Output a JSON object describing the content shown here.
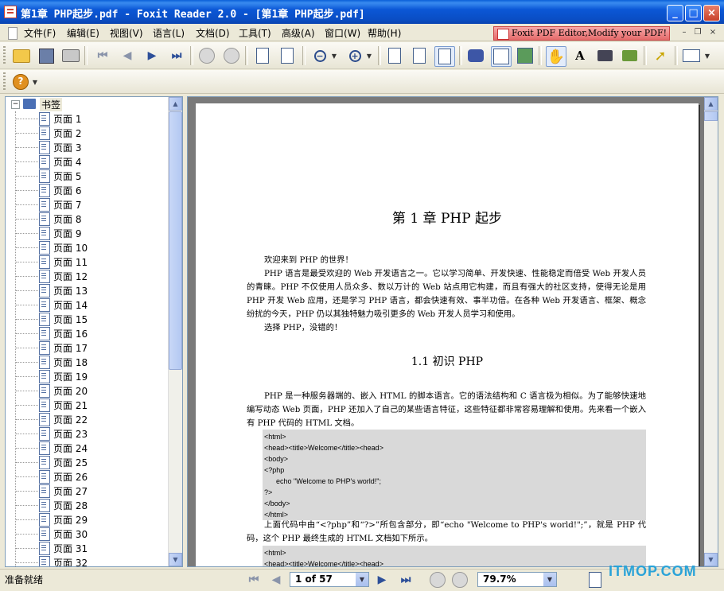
{
  "window": {
    "title": "第1章  PHP起步.pdf - Foxit Reader 2.0 - [第1章  PHP起步.pdf]",
    "minimize": "_",
    "maximize": "□",
    "close": "×"
  },
  "menu": {
    "items": [
      "文件(F)",
      "编辑(E)",
      "视图(V)",
      "语言(L)",
      "文档(D)",
      "工具(T)",
      "高级(A)",
      "窗口(W)",
      "帮助(H)"
    ],
    "promo": "Foxit PDF Editor,Modify your PDF!",
    "mdi_min": "–",
    "mdi_restore": "❐",
    "mdi_close": "×"
  },
  "toolbar": {
    "zoom_out": "−",
    "zoom_in": "+",
    "text_tool": "A",
    "help": "?"
  },
  "bookmarks": {
    "root": "书签",
    "toggle": "−",
    "items": [
      "页面 1",
      "页面 2",
      "页面 3",
      "页面 4",
      "页面 5",
      "页面 6",
      "页面 7",
      "页面 8",
      "页面 9",
      "页面 10",
      "页面 11",
      "页面 12",
      "页面 13",
      "页面 14",
      "页面 15",
      "页面 16",
      "页面 17",
      "页面 18",
      "页面 19",
      "页面 20",
      "页面 21",
      "页面 22",
      "页面 23",
      "页面 24",
      "页面 25",
      "页面 26",
      "页面 27",
      "页面 28",
      "页面 29",
      "页面 30",
      "页面 31",
      "页面 32"
    ]
  },
  "document": {
    "chapter_title": "第 1 章    PHP 起步",
    "intro_line": "欢迎来到 PHP 的世界！",
    "intro_para": "PHP 语言是最受欢迎的 Web 开发语言之一。它以学习简单、开发快速、性能稳定而倍受 Web 开发人员的青睐。PHP 不仅使用人员众多、数以万计的 Web 站点用它构建，而且有强大的社区支持，使得无论是用 PHP 开发 Web 应用，还是学习 PHP 语言，都会快速有效、事半功倍。在各种 Web 开发语言、框架、概念纷扰的今天，PHP 仍以其独特魅力吸引更多的 Web 开发人员学习和使用。",
    "intro_end": "选择 PHP，没错的！",
    "section_title": "1.1    初识 PHP",
    "section_para": "PHP 是一种服务器端的、嵌入 HTML 的脚本语言。它的语法结构和 C 语言极为相似。为了能够快速地编写动态 Web 页面，PHP 还加入了自己的某些语言特征，这些特征都非常容易理解和使用。先来看一个嵌入有 PHP 代码的 HTML 文档。",
    "code1": "<html>\n<head><title>Welcome</title><head>\n<body>\n<?php\n      echo \"Welcome to PHP's world!\";\n?>\n</body>\n</html>",
    "after_code": "上面代码中由“<?php”和“?>”所包含部分，即“echo \"Welcome to PHP's world!\";”，就是 PHP 代码，这个 PHP 最终生成的 HTML 文档如下所示。",
    "code2": "<html>\n<head><title>Welcome</title><head>"
  },
  "status": {
    "text": "准备就绪",
    "page": "1 of 57",
    "zoom": "79.7%"
  },
  "watermark": "ITMOP.COM"
}
